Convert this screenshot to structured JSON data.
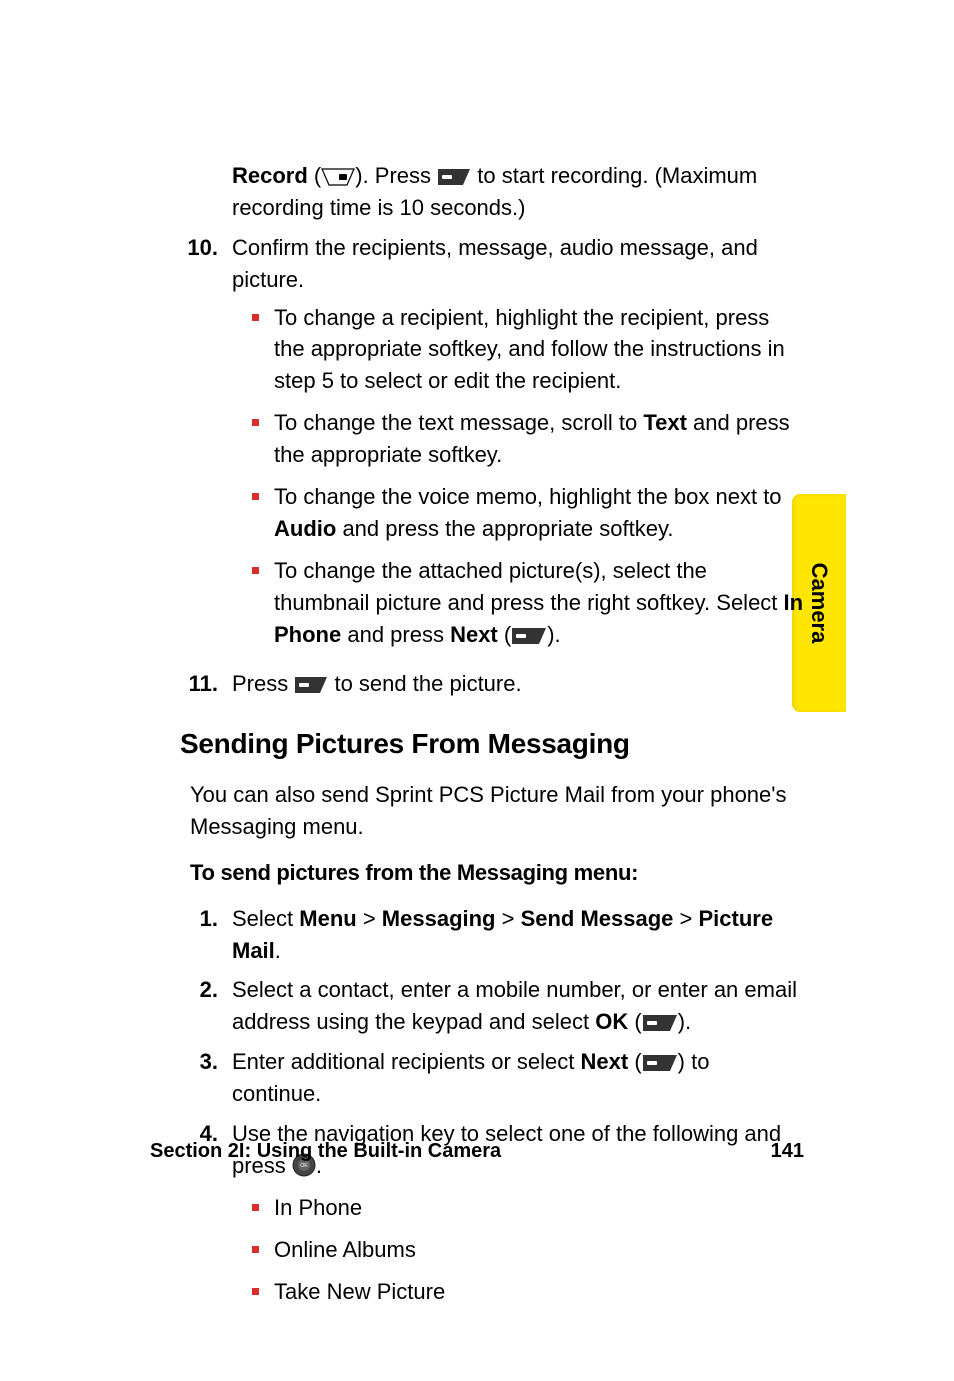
{
  "cont": {
    "record_bold": "Record",
    "record_paren_open": " (",
    "record_paren_close": "). Press ",
    "record_rest": " to start recording. (Maximum recording time is 10 seconds.)"
  },
  "step10": {
    "num": "10.",
    "text": "Confirm the recipients, message, audio message, and picture.",
    "b1": "To change a recipient, highlight the recipient, press the appropriate softkey, and follow the instructions in step 5 to select or edit the recipient.",
    "b2_a": "To change the text message, scroll to ",
    "b2_bold": "Text",
    "b2_b": " and press the appropriate softkey.",
    "b3_a": "To change the voice memo, highlight the box next to ",
    "b3_bold": "Audio",
    "b3_b": " and press the appropriate softkey.",
    "b4_a": "To change the attached picture(s), select the thumbnail picture and press the right softkey. Select ",
    "b4_bold1": "In Phone",
    "b4_mid": " and press ",
    "b4_bold2": "Next",
    "b4_paren_open": " (",
    "b4_paren_close": ")."
  },
  "step11": {
    "num": "11.",
    "a": "Press ",
    "b": " to send the picture."
  },
  "h2": "Sending Pictures From Messaging",
  "intro": "You can also send Sprint PCS Picture Mail from your phone's Messaging menu.",
  "lead": "To send pictures from the Messaging menu:",
  "s1": {
    "num": "1.",
    "a": "Select ",
    "m": "Menu",
    "g1": " > ",
    "msg": "Messaging",
    "g2": " > ",
    "sm": "Send Message",
    "g3": " > ",
    "pm": "Picture Mail",
    "end": "."
  },
  "s2": {
    "num": "2.",
    "a": "Select a contact, enter a mobile number, or enter an email address using the keypad and select ",
    "ok": "OK",
    "paren_open": " (",
    "paren_close": ")."
  },
  "s3": {
    "num": "3.",
    "a": "Enter additional recipients or select ",
    "next": "Next",
    "paren_open": " (",
    "paren_close": ") to continue."
  },
  "s4": {
    "num": "4.",
    "a": "Use the navigation key to select one of the following and press ",
    "end": ".",
    "opt1": "In Phone",
    "opt2": "Online Albums",
    "opt3": "Take New Picture"
  },
  "footer": {
    "left": "Section 2I: Using the Built-in Camera",
    "right": "141"
  },
  "tab": "Camera"
}
